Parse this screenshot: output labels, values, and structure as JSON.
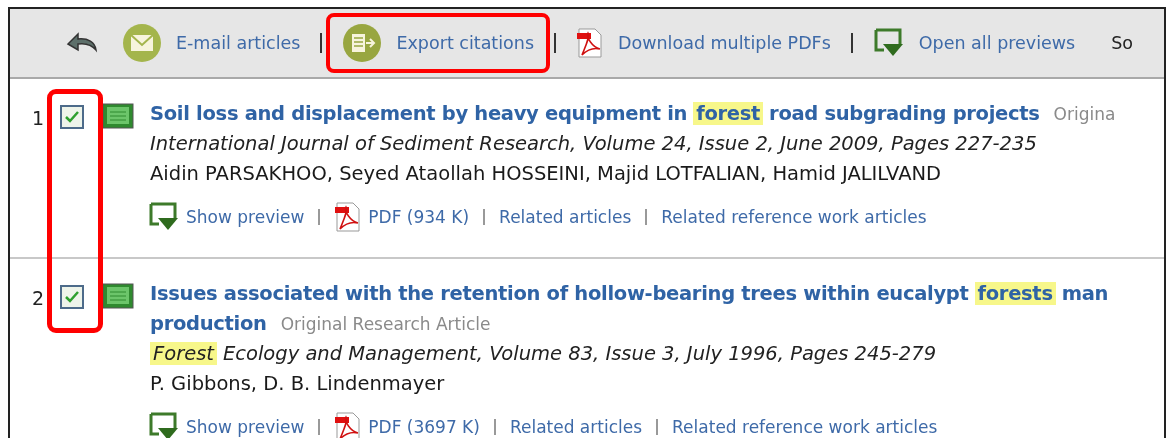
{
  "toolbar": {
    "items": [
      {
        "kind": "icon-only",
        "outlined": false
      },
      {
        "label": "E-mail articles",
        "kind": "link",
        "outlined": false
      },
      {
        "label": "Export citations",
        "kind": "link",
        "outlined": true
      },
      {
        "label": "Download multiple PDFs",
        "kind": "link",
        "outlined": false
      },
      {
        "label": "Open all previews",
        "kind": "link",
        "outlined": false
      }
    ],
    "sort_label": "So"
  },
  "checkbox_column_outlined": true,
  "articles": [
    {
      "number": "1",
      "checked": true,
      "title_lines": [
        [
          {
            "text": "Soil loss and displacement by heavy equipment in",
            "highlight": false
          },
          {
            "text": "forest",
            "highlight": true
          },
          {
            "text": "road subgrading projects",
            "highlight": false
          }
        ]
      ],
      "type": "Origina",
      "journal": [
        {
          "text": "International Journal of Sediment Research, Volume 24, Issue 2, June 2009, Pages 227-235",
          "highlight": false
        }
      ],
      "authors": "Aidin PARSAKHOO, Seyed Ataollah HOSSEINI, Majid LOTFALIAN, Hamid JALILVAND",
      "links": [
        "Show preview",
        "PDF (934 K)",
        "Related articles",
        "Related reference work articles"
      ]
    },
    {
      "number": "2",
      "checked": true,
      "title_lines": [
        [
          {
            "text": "Issues associated with the retention of hollow-bearing trees within eucalypt",
            "highlight": false
          },
          {
            "text": "forests",
            "highlight": true
          },
          {
            "text": "man",
            "highlight": false
          }
        ],
        [
          {
            "text": "production",
            "highlight": false
          }
        ]
      ],
      "type": "Original Research Article",
      "journal": [
        {
          "text": "Forest",
          "highlight": true
        },
        {
          "text": "Ecology and Management, Volume 83, Issue 3, July 1996, Pages 245-279",
          "highlight": false
        }
      ],
      "authors": "P. Gibbons, D. B. Lindenmayer",
      "links": [
        "Show preview",
        "PDF (3697 K)",
        "Related articles",
        "Related reference work articles"
      ]
    }
  ]
}
